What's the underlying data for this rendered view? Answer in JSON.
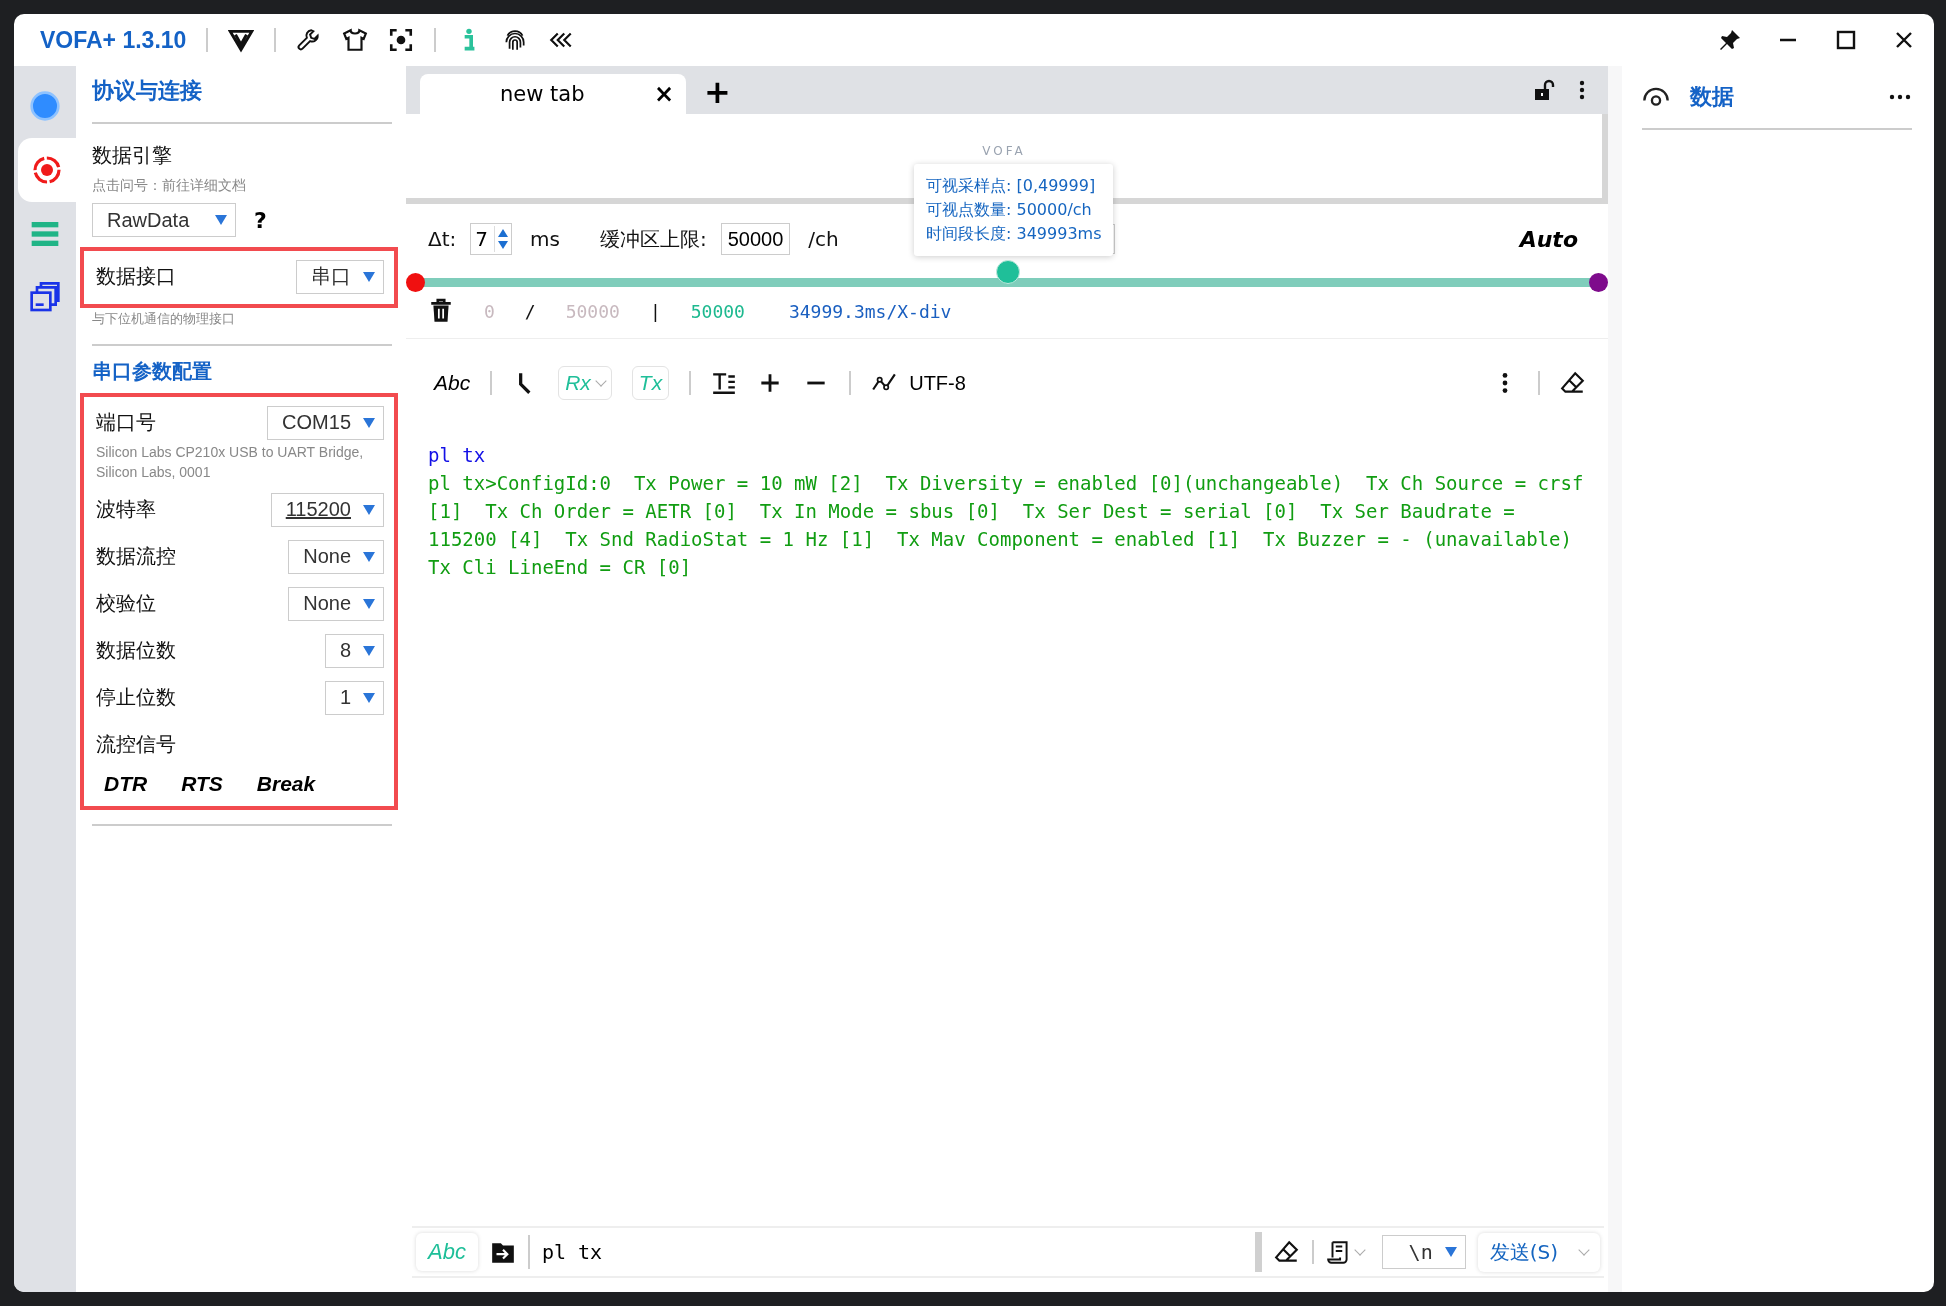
{
  "title_bar": {
    "app_name": "VOFA+ 1.3.10"
  },
  "side_rail": [
    {
      "kind": "connect",
      "selected": false
    },
    {
      "kind": "target",
      "selected": true
    },
    {
      "kind": "list",
      "selected": false
    },
    {
      "kind": "windows",
      "selected": false
    }
  ],
  "left_panel": {
    "title": "协议与连接",
    "engine": {
      "label": "数据引擎",
      "hint": "点击问号：前往详细文档",
      "value": "RawData",
      "help": "?"
    },
    "interface": {
      "label": "数据接口",
      "value": "串口",
      "hint": "与下位机通信的物理接口"
    },
    "serial_title": "串口参数配置",
    "fields": [
      {
        "label": "端口号",
        "value": "COM15",
        "underlined": false,
        "note": "Silicon Labs CP210x USB to UART Bridge, Silicon Labs, 0001"
      },
      {
        "label": "波特率",
        "value": "115200",
        "underlined": true
      },
      {
        "label": "数据流控",
        "value": "None",
        "underlined": false
      },
      {
        "label": "校验位",
        "value": "None",
        "underlined": false
      },
      {
        "label": "数据位数",
        "value": "8",
        "underlined": false
      },
      {
        "label": "停止位数",
        "value": "1",
        "underlined": false
      }
    ],
    "flow_signals": {
      "label": "流控信号",
      "buttons": [
        "DTR",
        "RTS",
        "Break"
      ]
    }
  },
  "tabs": [
    {
      "label": "new tab",
      "selected": true,
      "close": "×"
    }
  ],
  "add_tab": "+",
  "plot": {
    "logo": "VOFA",
    "tooltip": [
      "可视采样点: [0,49999]",
      "可视点数量: 50000/ch",
      "时间段长度: 349993ms"
    ]
  },
  "controls": {
    "dt_label": "Δt:",
    "dt_value": "7",
    "dt_unit": "ms",
    "buffer_label": "缓冲区上限:",
    "buffer_value": "50000",
    "buffer_unit": "/ch",
    "mode": "Auto"
  },
  "timeline": {
    "level": 0.5
  },
  "status": {
    "count": "0",
    "slash": "/",
    "total": "50000",
    "bar": "|",
    "visible": "50000",
    "scale": "34999.3ms/X-div"
  },
  "terminal_toolbar": {
    "format": "Abc",
    "rx": "Rx",
    "tx": "Tx",
    "encoding": "UTF-8"
  },
  "terminal_lines": [
    {
      "kind": "sent",
      "text": "pl tx"
    },
    {
      "kind": "received",
      "text": "pl tx>ConfigId:0  Tx Power = 10 mW [2]  Tx Diversity = enabled [0](unchangeable)  Tx Ch Source = crsf [1]  Tx Ch Order = AETR [0]  Tx In Mode = sbus [0]  Tx Ser Dest = serial [0]  Tx Ser Baudrate = 115200 [4]  Tx Snd RadioStat = 1 Hz [1]  Tx Mav Component = enabled [1]  Tx Buzzer = - (unavailable)  Tx Cli LineEnd = CR [0]"
    }
  ],
  "send_bar": {
    "format": "Abc",
    "input": "pl tx",
    "line_end": "\\n",
    "send": "发送(S)"
  },
  "right_panel": {
    "title": "数据"
  }
}
